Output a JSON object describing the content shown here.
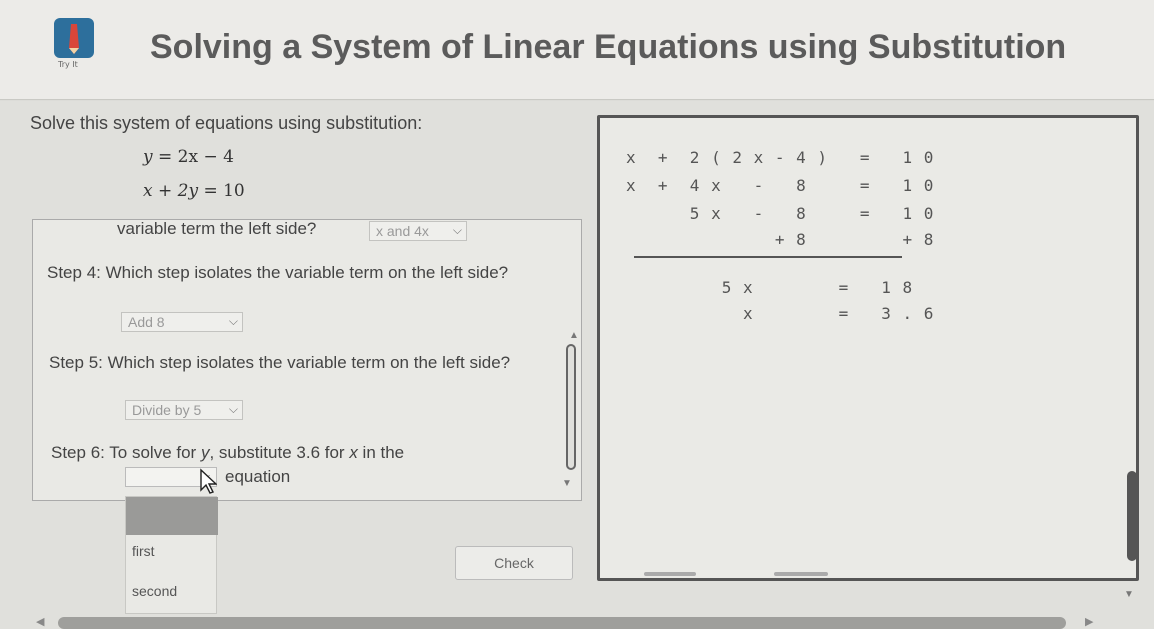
{
  "header": {
    "title": "Solving a System of Linear Equations using Substitution",
    "logo_caption": "Try It",
    "logo_icon": "pencil-logo-icon"
  },
  "problem": {
    "prompt": "Solve this system of equations using substitution:",
    "eq1": {
      "lhs": "y",
      "rhs": "= 2x − 4"
    },
    "eq2": {
      "lhs": "x + 2y",
      "rhs": "= 10"
    }
  },
  "steps": {
    "partial_text": "variable term the left side?",
    "partial_select": "x and 4x",
    "step4_text": "Step 4: Which step isolates the variable term on the left side?",
    "step4_select": "Add 8",
    "step5_text": "Step 5: Which step isolates the variable term on the left side?",
    "step5_select": "Divide by 5",
    "step6_prefix": "Step 6: To solve for",
    "step6_var": "y",
    "step6_mid": ", substitute 3.6 for",
    "step6_var2": "x",
    "step6_suffix": " in the",
    "step6_after": "equation",
    "dropdown_options": [
      "first",
      "second"
    ]
  },
  "check_label": "Check",
  "work": {
    "rows": [
      "x  +  2 ( 2 x - 4 )   =   1 0",
      "x  +  4 x   -   8     =   1 0",
      "      5 x   -   8     =   1 0",
      "              + 8         + 8",
      "         5 x        =   1 8",
      "           x        =   3 . 6"
    ]
  },
  "colors": {
    "background": "#e0e0dc",
    "panel": "#eaeae6",
    "border": "#555555",
    "title_text": "#5b5b5b"
  }
}
